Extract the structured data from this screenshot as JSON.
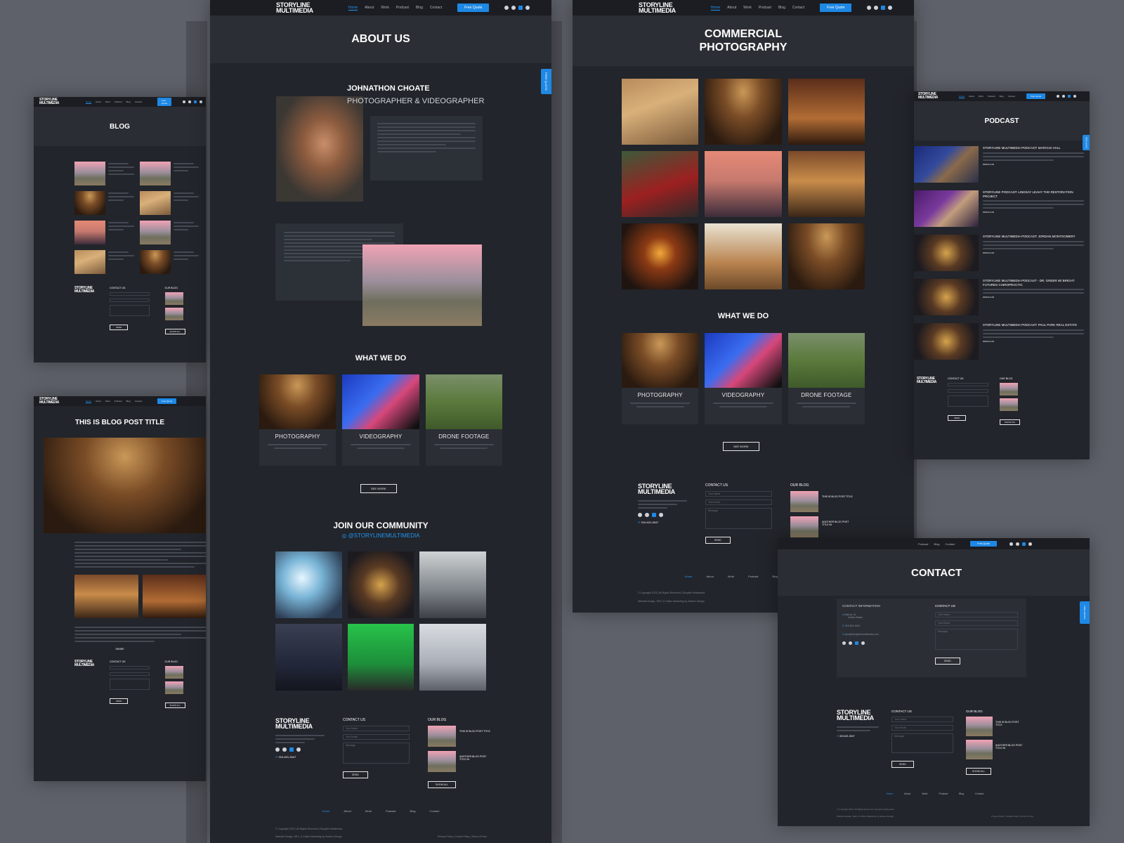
{
  "brand": {
    "logo_line1": "STORYLINE",
    "logo_line2": "MULTIMEDIA",
    "accent": "#1e88e5"
  },
  "nav": {
    "links": [
      "Home",
      "About",
      "Work",
      "Podcast",
      "Blog",
      "Contact"
    ],
    "quote": "Free Quote"
  },
  "side_tab": "FREE QUOTE",
  "about": {
    "title": "ABOUT US",
    "name": "JOHNATHON CHOATE",
    "role": "PHOTOGRAPHER & VIDEOGRAPHER",
    "what_we_do": "WHAT WE DO",
    "services": [
      {
        "title": "PHOTOGRAPHY"
      },
      {
        "title": "VIDEOGRAPHY"
      },
      {
        "title": "DRONE FOOTAGE"
      }
    ],
    "see_work": "SEE WORK",
    "community_title": "JOIN OUR COMMUNITY",
    "community_handle": "@STORYLINEMULTIMEDIA"
  },
  "footer": {
    "contact_us": "CONTACT US",
    "our_blog": "OUR BLOG",
    "phone": "319-621-5047",
    "name_ph": "Your Name",
    "email_ph": "Your Email",
    "message_ph": "Message",
    "send": "SEND",
    "show_all": "SHOW ALL",
    "blog_posts": [
      "THIS IS BLOG POST TITLE",
      "ANOTHER BLOG POST TITLE IN"
    ],
    "links": [
      "Home",
      "About",
      "Work",
      "Podcast",
      "Blog",
      "Contact"
    ],
    "copyright": "© Copyright 2023 | All Rights Reserved | Storyline Multimedia",
    "credit": "Website Design, SEO, & Online Marketing by Sixteen Design",
    "legal": "Privacy Policy | Cookie Policy | Terms Of Use"
  },
  "commercial": {
    "title_line1": "COMMERCIAL",
    "title_line2": "PHOTOGRAPHY",
    "what_we_do": "WHAT WE DO",
    "services": [
      {
        "title": "PHOTOGRAPHY"
      },
      {
        "title": "VIDEOGRAPHY"
      },
      {
        "title": "DRONE FOOTAGE"
      }
    ],
    "see_work": "SEE WORK"
  },
  "blog": {
    "title": "BLOG"
  },
  "blog_post": {
    "title": "THIS IS BLOG POST TITLE",
    "share": "SHARE"
  },
  "podcast": {
    "title": "PODCAST",
    "watch_on": "WATCH ON",
    "episodes": [
      "STORYLINE MULTIMEDIA PODCAST: MARCUS HALL",
      "STORYLINE PODCAST: LINDSAY LEAHY THE RESTORATION PROJECT",
      "STORYLINE MULTIMEDIA PODCAST: JORDAN MONTGOMERY",
      "STORYLINE MULTIMEDIA PODCAST - DR. GREER W/ BRIGHT FUTURES CHIROPRACTIC",
      "STORYLINE MULTIMEDIA PODCAST: PAUL PARK REAL ESTATE"
    ]
  },
  "contact": {
    "title": "CONTACT",
    "info_title": "CONTACT INFORMATION",
    "form_title": "CONTACT US",
    "address_line1": "Kalona, IA",
    "address_line2": "United States",
    "phone": "319-621-5047",
    "email": "john@storylinemultimedia.com",
    "send": "SEND"
  }
}
